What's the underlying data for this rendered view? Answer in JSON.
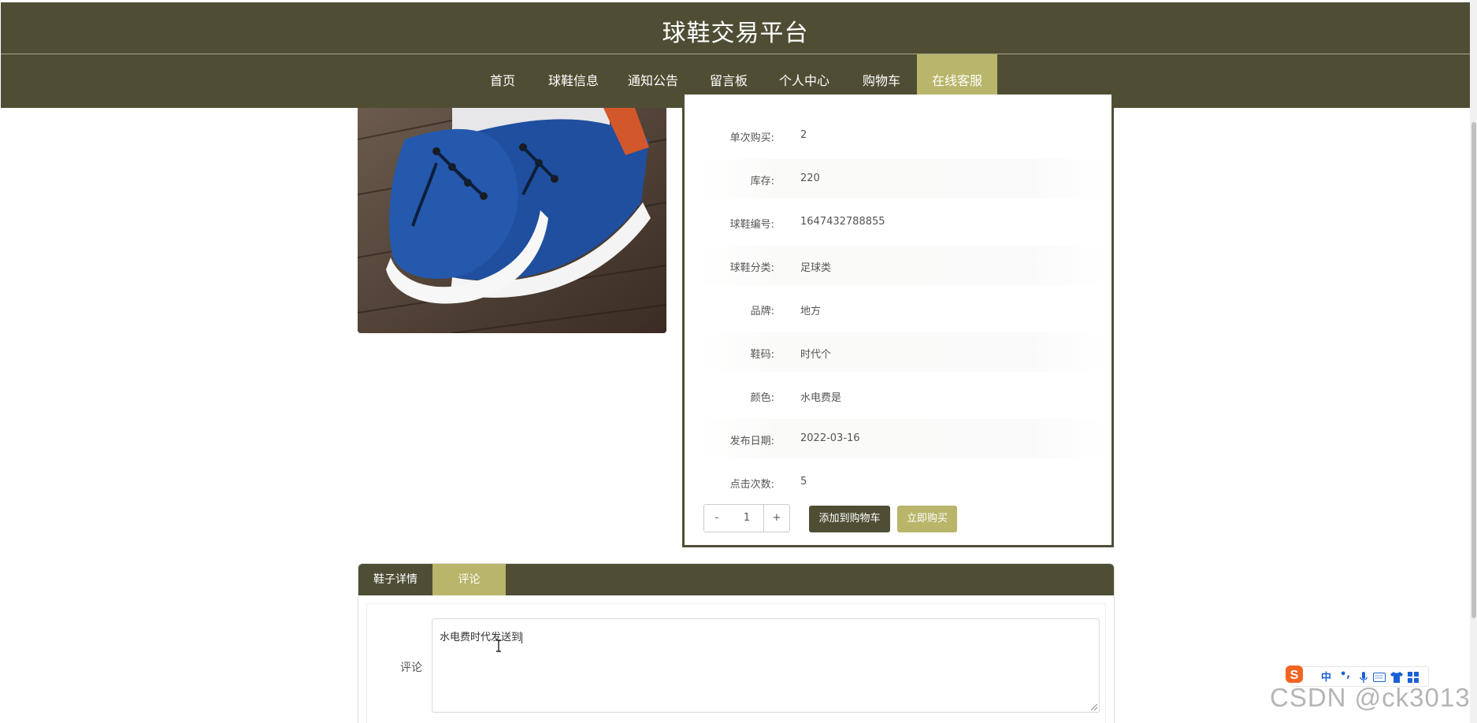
{
  "header": {
    "title": "球鞋交易平台"
  },
  "nav": {
    "items": [
      {
        "label": "首页"
      },
      {
        "label": "球鞋信息"
      },
      {
        "label": "通知公告"
      },
      {
        "label": "留言板"
      },
      {
        "label": "个人中心"
      },
      {
        "label": "购物车"
      },
      {
        "label": "在线客服"
      }
    ],
    "active": "在线客服"
  },
  "product": {
    "image_icon": "blue-sneaker-image",
    "details": [
      {
        "label": "单次购买:",
        "value": "2"
      },
      {
        "label": "库存:",
        "value": "220"
      },
      {
        "label": "球鞋编号:",
        "value": "1647432788855"
      },
      {
        "label": "球鞋分类:",
        "value": "足球类"
      },
      {
        "label": "品牌:",
        "value": "地方"
      },
      {
        "label": "鞋码:",
        "value": "时代个"
      },
      {
        "label": "颜色:",
        "value": "水电费是"
      },
      {
        "label": "发布日期:",
        "value": "2022-03-16"
      },
      {
        "label": "点击次数:",
        "value": "5"
      }
    ],
    "quantity": {
      "minus": "-",
      "value": "1",
      "plus": "+"
    },
    "add_to_cart_label": "添加到购物车",
    "buy_now_label": "立即购买"
  },
  "tabs": {
    "items": [
      {
        "label": "鞋子详情"
      },
      {
        "label": "评论"
      }
    ],
    "active": "评论"
  },
  "comment": {
    "label": "评论",
    "value": "水电费时代发送到"
  },
  "ime_toolbar": {
    "mode": "中",
    "punct": "•,",
    "logo_icon": "sogou-s-icon"
  },
  "watermark": "CSDN @ck3013",
  "colors": {
    "primary": "#4f4e35",
    "accent": "#b9b56a"
  }
}
